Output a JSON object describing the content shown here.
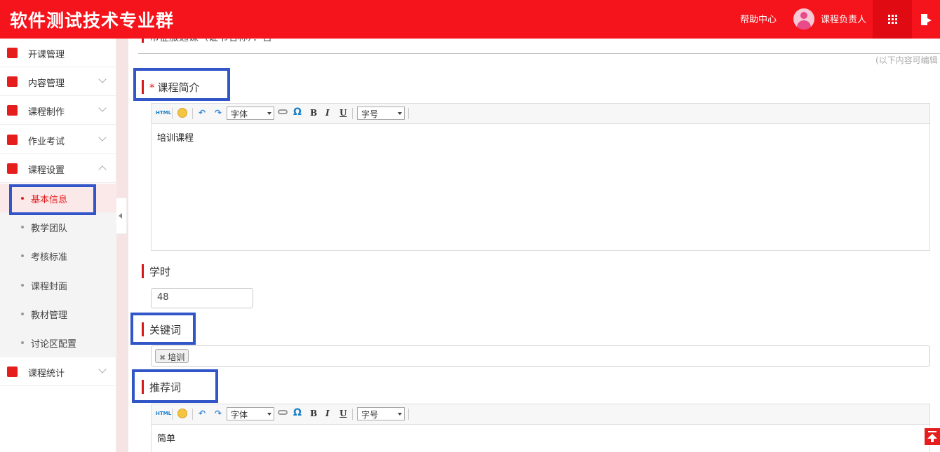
{
  "header": {
    "brand": "软件测试技术专业群",
    "help": "帮助中心",
    "user": "课程负责人"
  },
  "sidebar": {
    "items": [
      {
        "label": "开课管理",
        "icon": "speaker-book-icon"
      },
      {
        "label": "内容管理",
        "icon": "cube-icon"
      },
      {
        "label": "课程制作",
        "icon": "edit-icon"
      },
      {
        "label": "作业考试",
        "icon": "exam-icon"
      },
      {
        "label": "课程设置",
        "icon": "document-icon"
      },
      {
        "label": "课程统计",
        "icon": "document-icon"
      }
    ],
    "submenu": [
      "基本信息",
      "教学团队",
      "考核标准",
      "课程封面",
      "教材管理",
      "讨论区配置"
    ]
  },
  "main": {
    "cut_label": "市征服通课（证书名称）：否",
    "editable_note": "(以下内容可编辑",
    "intro_label": "课程简介",
    "intro_required": "*",
    "intro_content": "培训课程",
    "hours_label": "学时",
    "hours_value": "48",
    "keywords_label": "关键词",
    "keyword_tag": "培训",
    "recommend_label": "推荐词",
    "recommend_content": "简单"
  },
  "toolbar": {
    "html": "HTML",
    "font": "字体",
    "size": "字号",
    "omega": "Ω",
    "bold": "B",
    "italic": "I",
    "underline": "U",
    "undo": "↶",
    "redo": "↷"
  },
  "colors": {
    "brand_red": "#f5141c",
    "highlight_blue": "#3255c8",
    "accent_red": "#e51d1d"
  }
}
